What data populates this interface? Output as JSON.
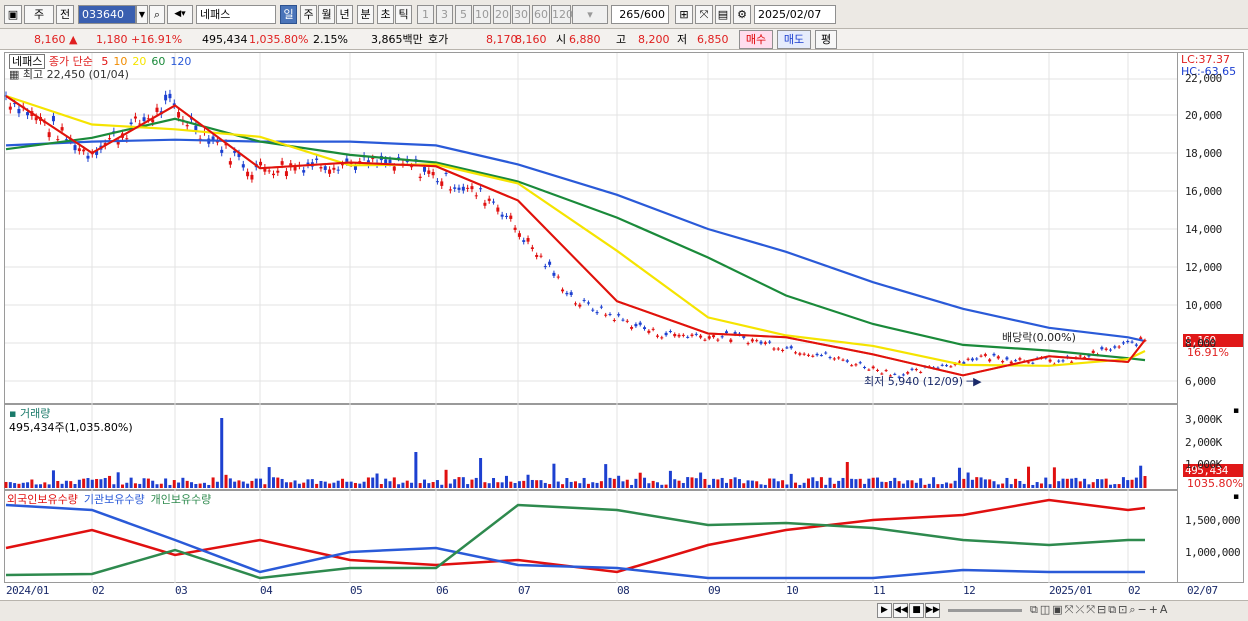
{
  "toolbar": {
    "market": "주",
    "type": "전",
    "code": "033640",
    "name": "네패스",
    "periods": [
      "일",
      "주",
      "월",
      "년",
      "분",
      "초",
      "틱"
    ],
    "nums": [
      "1",
      "3",
      "5",
      "10",
      "20",
      "30",
      "60",
      "120"
    ],
    "count": "265",
    "count_total": "/600",
    "date": "2025/02/07"
  },
  "quote": {
    "price": "8,160",
    "change": "1,180",
    "change_pct": "+16.91%",
    "volume": "495,434",
    "volume_pct": "1,035.80%",
    "turnover": "2.15%",
    "amount": "3,865백만",
    "ask_label": "호가",
    "ask1": "8,170",
    "ask2": "8,160",
    "open_label": "시",
    "open": "6,880",
    "high_label": "고",
    "high": "8,200",
    "low_label": "저",
    "low": "6,850",
    "buy": "매수",
    "sell": "매도",
    "eval": "평"
  },
  "price_pane": {
    "legend_name": "네패스",
    "legend_ma": "종가 단순",
    "ma_labels": [
      "5",
      "10",
      "20",
      "60",
      "120"
    ],
    "ma_colors": [
      "#e01010",
      "#f08c00",
      "#f5e400",
      "#1a8a3a",
      "#2a5ad8"
    ],
    "high_note": "최고 22,450 (01/04)",
    "low_note": "최저 5,940 (12/09)",
    "div_note": "배당락(0.00%)",
    "lc": "LC:37.37",
    "hc": "HC:-63.65",
    "yticks": [
      "22,000",
      "20,000",
      "18,000",
      "16,000",
      "14,000",
      "12,000",
      "10,000",
      "8,000",
      "6,000"
    ],
    "price_tag": "8,160",
    "pct_tag": "16.91%"
  },
  "volume_pane": {
    "title": "거래량",
    "sub": "495,434주(1,035.80%)",
    "yticks": [
      "3,000K",
      "2,000K",
      "1,000K"
    ],
    "tag": "495,434",
    "tag2": "1035.80%"
  },
  "holding_pane": {
    "labels": [
      "외국인보유수량",
      "기관보유수량",
      "개인보유수량"
    ],
    "colors": [
      "#e01010",
      "#2a5ad8",
      "#2e8a4e"
    ],
    "yticks": [
      "1,500,000",
      "1,000,000"
    ]
  },
  "xaxis": [
    "2024/01",
    "02",
    "03",
    "04",
    "05",
    "06",
    "07",
    "08",
    "09",
    "10",
    "11",
    "12",
    "2025/01",
    "02",
    "02/07"
  ],
  "chart_data": {
    "type": "line",
    "title": "네패스",
    "x": [
      "2024/01",
      "02",
      "03",
      "04",
      "05",
      "06",
      "07",
      "08",
      "09",
      "10",
      "11",
      "12",
      "2025/01",
      "02",
      "02/07"
    ],
    "series": [
      {
        "name": "종가",
        "values": [
          21000,
          18000,
          20500,
          17200,
          17500,
          17300,
          15500,
          10200,
          8500,
          8300,
          7400,
          6300,
          7300,
          7000,
          8160
        ]
      },
      {
        "name": "120",
        "values": [
          18400,
          18600,
          18700,
          18600,
          18600,
          18400,
          17400,
          15800,
          14000,
          12800,
          11200,
          9800,
          8800,
          8300,
          8100
        ]
      },
      {
        "name": "60",
        "values": [
          18200,
          18800,
          19800,
          18600,
          17900,
          17500,
          16500,
          14600,
          12500,
          10500,
          9000,
          7900,
          7600,
          7200,
          7100
        ]
      }
    ],
    "ylim": [
      5000,
      23000
    ]
  }
}
